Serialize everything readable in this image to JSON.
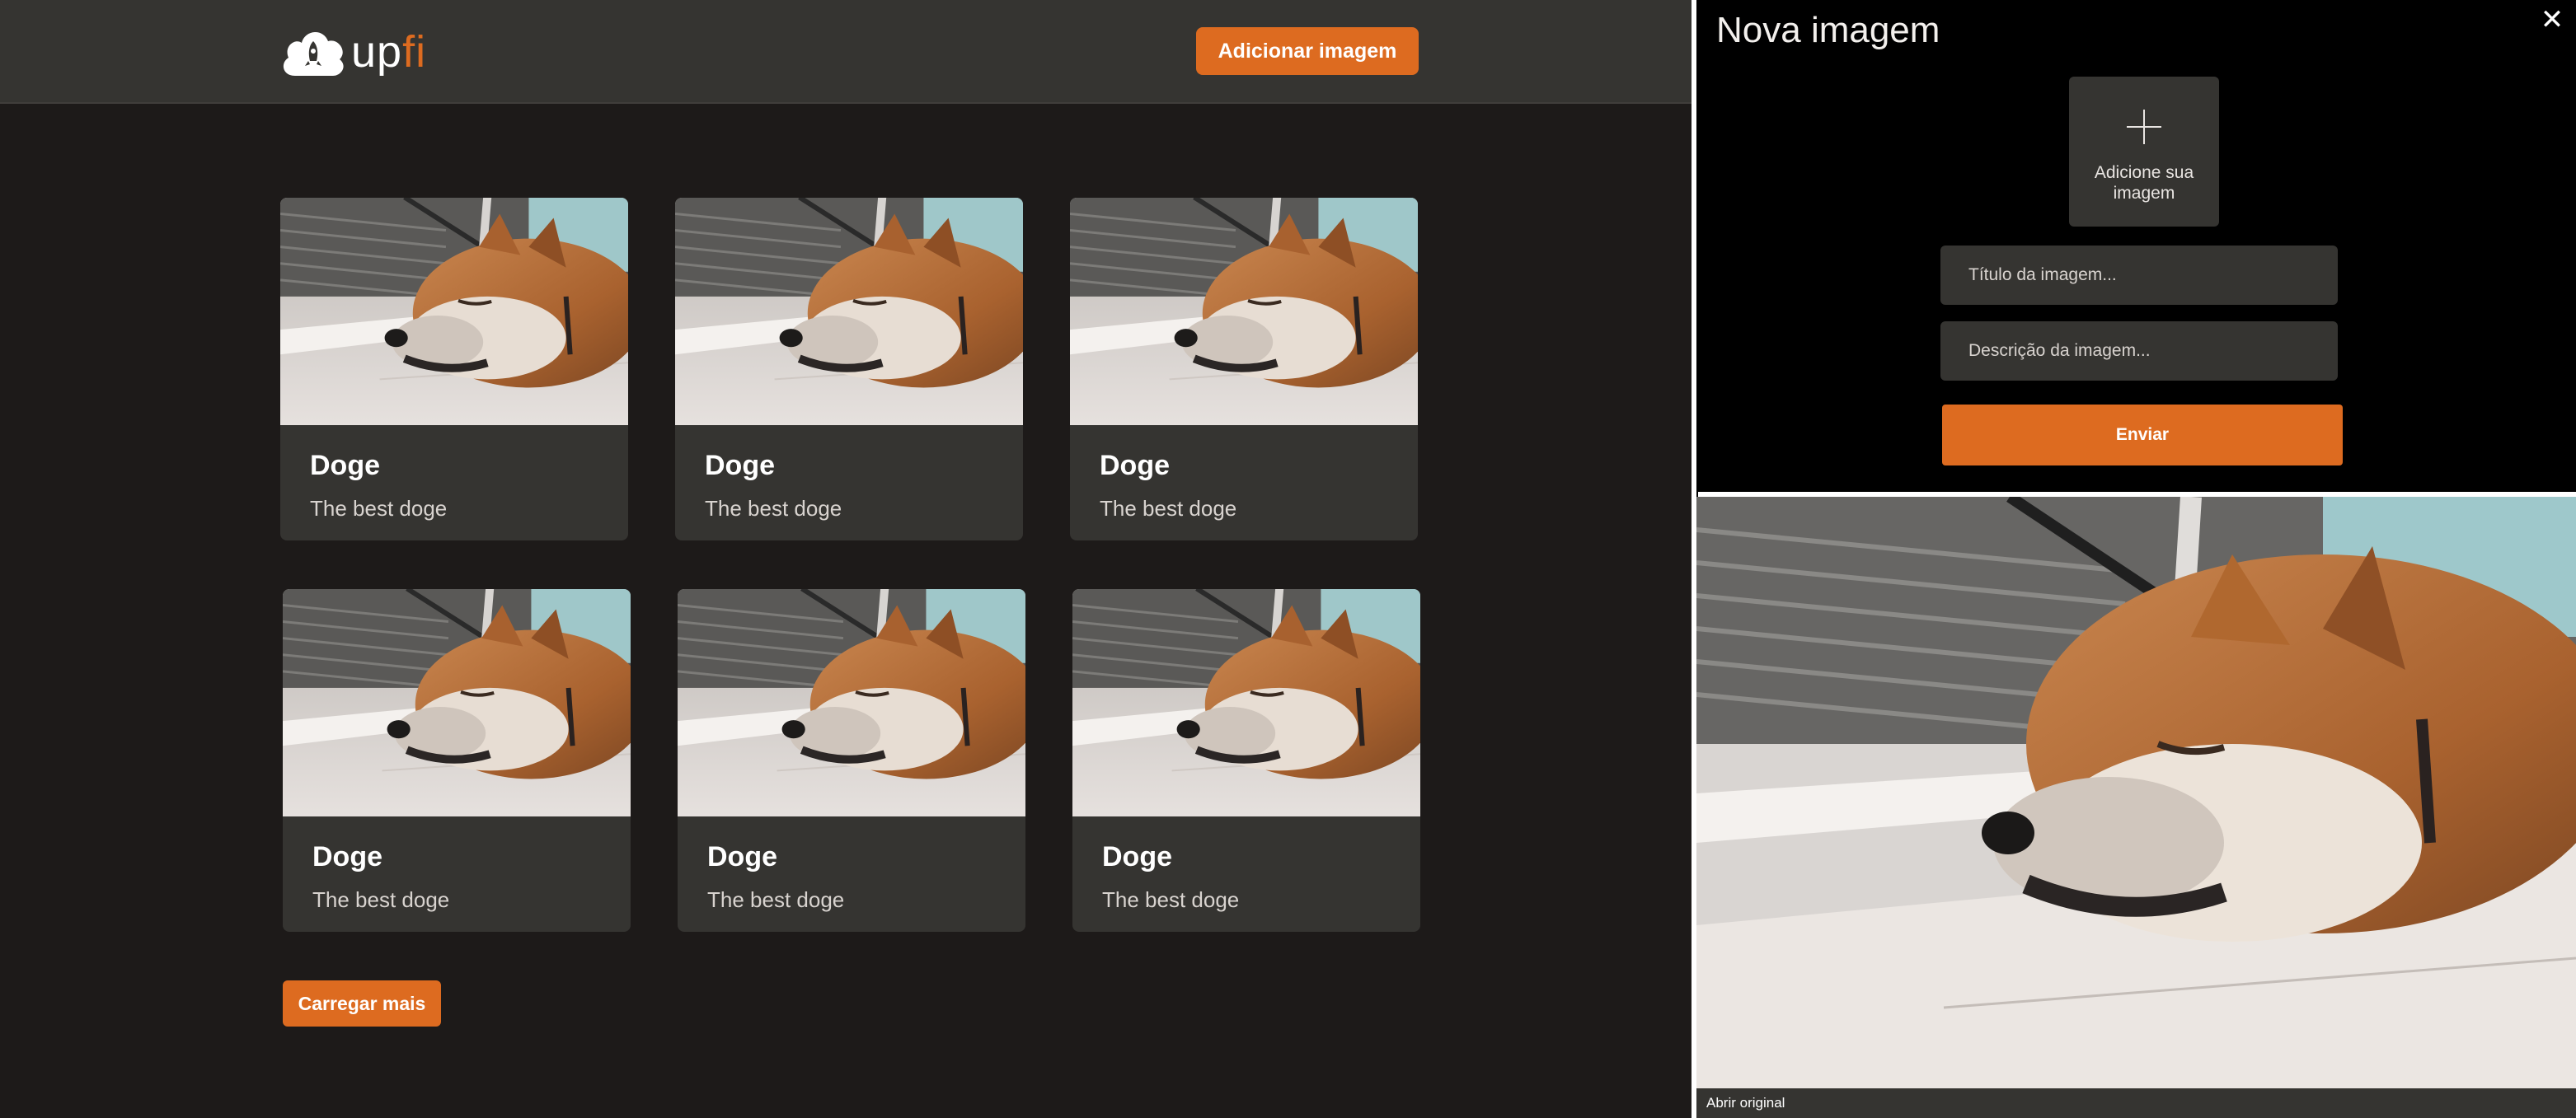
{
  "header": {
    "logo_text_main": "up",
    "logo_text_accent": "fi",
    "add_button": "Adicionar imagem"
  },
  "colors": {
    "accent": "#dd6b20",
    "background": "#1d1a19",
    "card": "#353431"
  },
  "gallery": {
    "cards": [
      {
        "title": "Doge",
        "description": "The best doge"
      },
      {
        "title": "Doge",
        "description": "The best doge"
      },
      {
        "title": "Doge",
        "description": "The best doge"
      },
      {
        "title": "Doge",
        "description": "The best doge"
      },
      {
        "title": "Doge",
        "description": "The best doge"
      },
      {
        "title": "Doge",
        "description": "The best doge"
      }
    ],
    "load_more": "Carregar mais"
  },
  "modal": {
    "title": "Nova imagem",
    "close_icon": "close-icon",
    "upload_label": "Adicione sua imagem",
    "title_placeholder": "Título da imagem...",
    "description_placeholder": "Descrição da imagem...",
    "submit": "Enviar",
    "open_original": "Abrir original"
  }
}
